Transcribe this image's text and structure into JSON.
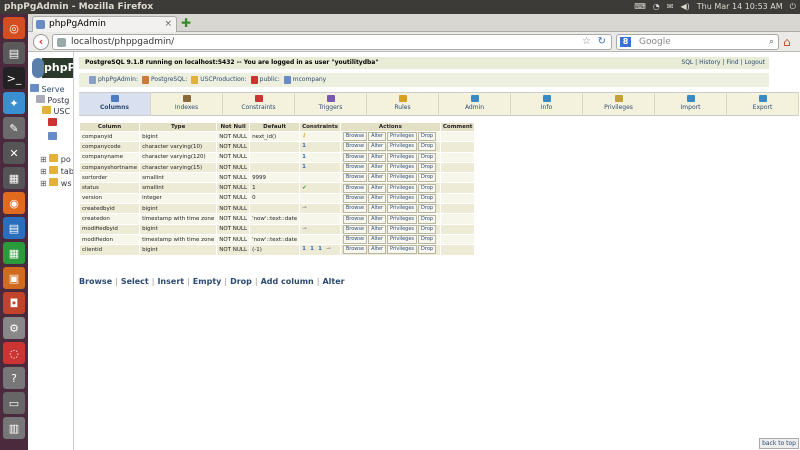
{
  "os": {
    "window_title": "phpPgAdmin - Mozilla Firefox",
    "clock": "Thu Mar 14 10:53 AM"
  },
  "browser": {
    "tab_title": "phpPgAdmin",
    "url": "localhost/phppgadmin/",
    "search_placeholder": "Google",
    "search_engine_letter": "8"
  },
  "left": {
    "logo": "phpP",
    "tree": [
      "Serve",
      "Postg",
      "USC",
      "po",
      "tab",
      "ws"
    ]
  },
  "header": {
    "server_info_prefix": "PostgreSQL 9.1.8 running on ",
    "server_host": "localhost:5432",
    "server_info_mid": " -- You are logged in as user ",
    "server_user": "\"youtilitydba\"",
    "links": [
      "SQL",
      "History",
      "Find",
      "Logout"
    ]
  },
  "trail": [
    {
      "label": "phpPgAdmin",
      "color": "#8aa0c8"
    },
    {
      "label": "PostgreSQL",
      "color": "#d07a3a"
    },
    {
      "label": "USCProduction",
      "color": "#e2b13a"
    },
    {
      "label": "public",
      "color": "#c33"
    },
    {
      "label": "mcompany",
      "color": "#6a8cc4"
    }
  ],
  "tabs": [
    {
      "label": "Columns",
      "active": true,
      "color": "#4a7ac4"
    },
    {
      "label": "Indexes",
      "active": false,
      "color": "#8a6a3a"
    },
    {
      "label": "Constraints",
      "active": false,
      "color": "#c33"
    },
    {
      "label": "Triggers",
      "active": false,
      "color": "#7a5ab0"
    },
    {
      "label": "Rules",
      "active": false,
      "color": "#d8a020"
    },
    {
      "label": "Admin",
      "active": false,
      "color": "#3a8ac4"
    },
    {
      "label": "Info",
      "active": false,
      "color": "#3a8ac4"
    },
    {
      "label": "Privileges",
      "active": false,
      "color": "#c4a03a"
    },
    {
      "label": "Import",
      "active": false,
      "color": "#3a8ac4"
    },
    {
      "label": "Export",
      "active": false,
      "color": "#3a8ac4"
    }
  ],
  "table": {
    "headers": [
      "Column",
      "Type",
      "Not Null",
      "Default",
      "Constraints",
      "Actions",
      "Comment"
    ],
    "actions": [
      "Browse",
      "Alter",
      "Privileges",
      "Drop"
    ],
    "rows": [
      {
        "column": "companyid",
        "type": "bigint",
        "notnull": "NOT NULL",
        "default": "next_id()",
        "constraints": "key-icon"
      },
      {
        "column": "companycode",
        "type": "character varying(10)",
        "notnull": "NOT NULL",
        "default": "",
        "constraints": "unique-icon"
      },
      {
        "column": "companyname",
        "type": "character varying(120)",
        "notnull": "NOT NULL",
        "default": "",
        "constraints": "unique-icon"
      },
      {
        "column": "companyshortname",
        "type": "character varying(15)",
        "notnull": "NOT NULL",
        "default": "",
        "constraints": "unique-icon"
      },
      {
        "column": "sortorder",
        "type": "smallint",
        "notnull": "NOT NULL",
        "default": "9999",
        "constraints": ""
      },
      {
        "column": "status",
        "type": "smallint",
        "notnull": "NOT NULL",
        "default": "1",
        "constraints": "check-icon"
      },
      {
        "column": "version",
        "type": "integer",
        "notnull": "NOT NULL",
        "default": "0",
        "constraints": ""
      },
      {
        "column": "createdbyid",
        "type": "bigint",
        "notnull": "NOT NULL",
        "default": "",
        "constraints": "fkey-icon"
      },
      {
        "column": "createdon",
        "type": "timestamp with time zone",
        "notnull": "NOT NULL",
        "default": "'now'::text::date",
        "constraints": ""
      },
      {
        "column": "modifiedbyid",
        "type": "bigint",
        "notnull": "NOT NULL",
        "default": "",
        "constraints": "fkey-icon"
      },
      {
        "column": "modifiedon",
        "type": "timestamp with time zone",
        "notnull": "NOT NULL",
        "default": "'now'::text::date",
        "constraints": ""
      },
      {
        "column": "clientid",
        "type": "bigint",
        "notnull": "NOT NULL",
        "default": "(-1)",
        "constraints": "multi-icon"
      }
    ]
  },
  "bottom_links": [
    "Browse",
    "Select",
    "Insert",
    "Empty",
    "Drop",
    "Add column",
    "Alter"
  ],
  "back_to_top": "back to top"
}
